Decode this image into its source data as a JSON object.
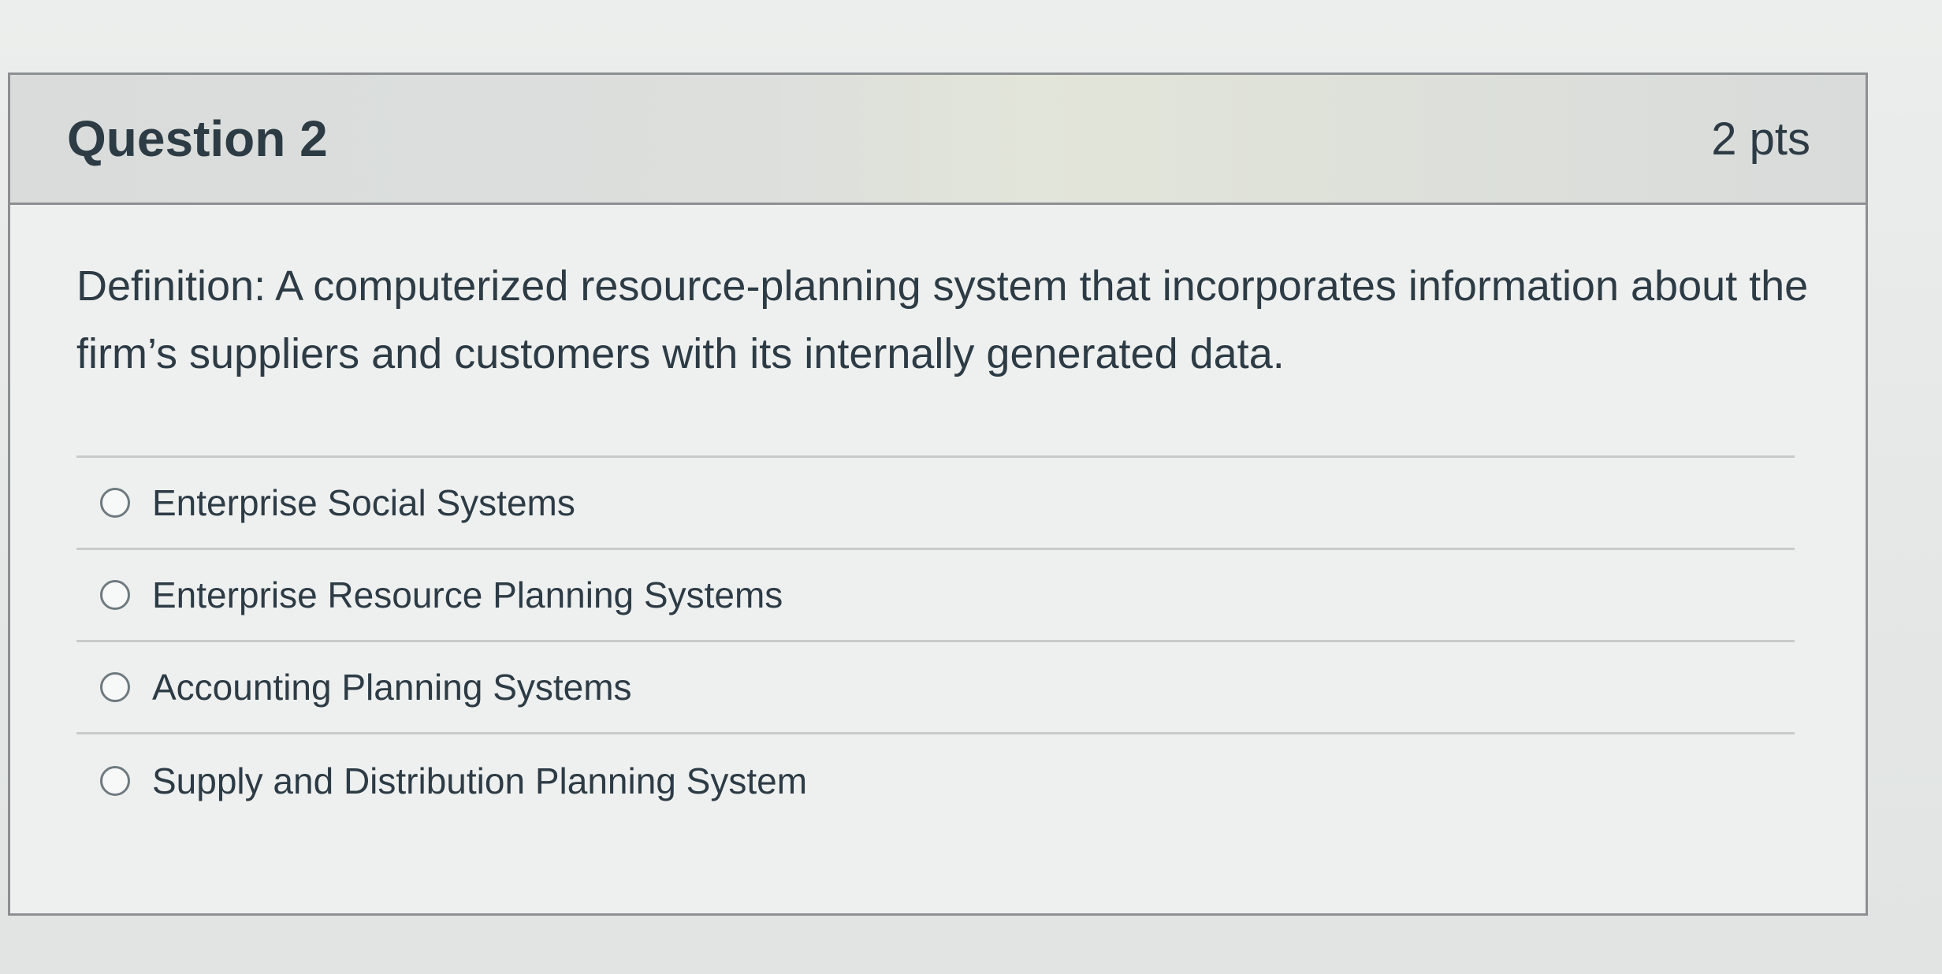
{
  "question": {
    "title": "Question 2",
    "points": "2 pts",
    "text": "Definition: A computerized resource-planning system that incorporates information about the firm’s suppliers and customers with its internally generated data."
  },
  "answers": [
    {
      "label": "Enterprise Social Systems"
    },
    {
      "label": "Enterprise Resource Planning Systems"
    },
    {
      "label": "Accounting Planning Systems"
    },
    {
      "label": "Supply and Distribution Planning System"
    }
  ],
  "colors": {
    "text": "#2d3b45",
    "header_bg": "#d9dcdb",
    "border": "#8c9092"
  }
}
